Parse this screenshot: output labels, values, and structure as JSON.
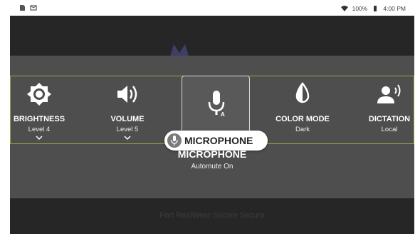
{
  "status_bar": {
    "battery": "100%",
    "time": "4:00 PM",
    "icons": [
      "sd-card-icon",
      "mail-icon",
      "wifi-icon",
      "battery-icon"
    ]
  },
  "background": {
    "footer_text": "Fort RealWear Secure Secure"
  },
  "controls": [
    {
      "id": "brightness",
      "label": "BRIGHTNESS",
      "value": "Level 4",
      "icon": "brightness-icon"
    },
    {
      "id": "volume",
      "label": "VOLUME",
      "value": "Level 5",
      "icon": "volume-icon"
    },
    {
      "id": "microphone",
      "label": "",
      "value": "",
      "icon": "microphone-icon"
    },
    {
      "id": "color-mode",
      "label": "COLOR MODE",
      "value": "Dark",
      "icon": "color-mode-icon"
    },
    {
      "id": "dictation",
      "label": "DICTATION",
      "value": "Local",
      "icon": "dictation-icon"
    }
  ],
  "voice_pill": {
    "label": "MICROPHONE"
  },
  "caption": {
    "title": "MICROPHONE",
    "subtitle": "Automute On"
  },
  "colors": {
    "highlight_border": "#9aa54a",
    "overlay": "#4e4e4e",
    "screen": "#262626"
  }
}
